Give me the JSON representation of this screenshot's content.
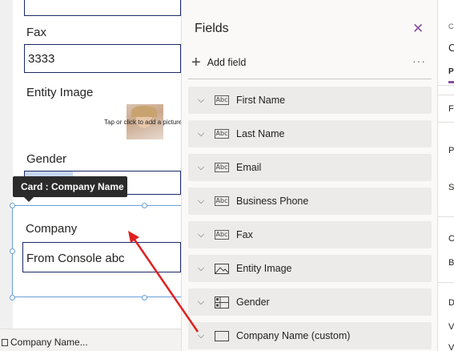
{
  "canvas": {
    "fax": {
      "label": "Fax",
      "value": "3333"
    },
    "entity_image": {
      "label": "Entity Image",
      "placeholder": "Tap or click to add a picture"
    },
    "gender": {
      "label": "Gender"
    },
    "company": {
      "label": "Company",
      "value": "From Console abc"
    },
    "tooltip": "Card : Company Name",
    "bottom_tab": "Company Name..."
  },
  "fields_panel": {
    "title": "Fields",
    "add_field": "Add field",
    "more": "···",
    "items": [
      {
        "label": "First Name",
        "icon": "text-field-icon",
        "icon_text": "Abc"
      },
      {
        "label": "Last Name",
        "icon": "text-field-icon",
        "icon_text": "Abc"
      },
      {
        "label": "Email",
        "icon": "text-field-icon",
        "icon_text": "Abc"
      },
      {
        "label": "Business Phone",
        "icon": "text-field-icon",
        "icon_text": "Abc"
      },
      {
        "label": "Fax",
        "icon": "text-field-icon",
        "icon_text": "Abc"
      },
      {
        "label": "Entity Image",
        "icon": "image-field-icon"
      },
      {
        "label": "Gender",
        "icon": "choice-field-icon"
      },
      {
        "label": "Company Name (custom)",
        "icon": "card-field-icon"
      }
    ]
  },
  "props_strip": {
    "t1": "C",
    "t2": "C",
    "tab": "P",
    "t3": "Fi",
    "t4": "P",
    "t5": "Si",
    "t6": "C",
    "t7": "B",
    "t8": "D",
    "t9": "V",
    "t10": "V"
  },
  "colors": {
    "accent": "#6aa0d8",
    "arrow": "#e02020",
    "close": "#8a4f9e",
    "input_border": "#1b2a6b"
  }
}
